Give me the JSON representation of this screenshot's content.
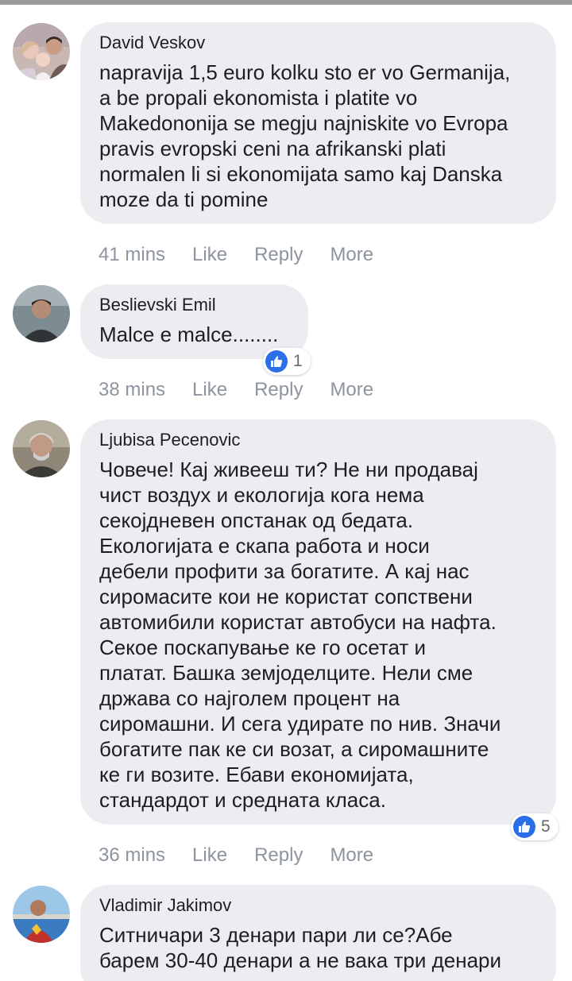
{
  "comments": [
    {
      "author": "David Veskov",
      "text": "napravija 1,5 euro kolku sto er vo Germanija,\na be propali ekonomista i platite vo\nMakedononija se megju najniskite vo Evropa\npravis evropski ceni na afrikanski plati\nnormalen li si ekonomijata samo kaj Danska\nmoze da ti pomine",
      "time": "41 mins",
      "like": "Like",
      "reply": "Reply",
      "more": "More",
      "reactions": null
    },
    {
      "author": "Beslievski Emil",
      "text": "Malce e malce........",
      "time": "38 mins",
      "like": "Like",
      "reply": "Reply",
      "more": "More",
      "reactions": "1"
    },
    {
      "author": "Ljubisa Pecenovic",
      "text": "Човече! Кај живееш ти? Не ни продавај\nчист воздух и екологија кога нема\nсекојдневен опстанак од бедата.\nЕкологијата е скапа работа и носи\nдебели профити за богатите. А кај нас\nсиромасите кои не користат сопствени\nавтомибили користат автобуси на нафта.\nСекое поскапување ке го осетат и\nплатат. Башка земјоделците. Нели сме\nдржава со најголем процент на\nсиромашни. И сега удирате по нив. Значи\nбогатите пак ке си возат, а сиромашните\nке ги возите. Ебави економијата,\nстандардот и средната класа.",
      "time": "36 mins",
      "like": "Like",
      "reply": "Reply",
      "more": "More",
      "reactions": "5"
    },
    {
      "author": "Vladimir Jakimov",
      "text": "Ситничари 3 денари пари ли се?Абе\nбарем 30-40 денари а не вака три денари",
      "reactions": null
    }
  ],
  "icons": {
    "like_badge": "thumbs-up-icon",
    "like_color": "#2a6ee8"
  }
}
